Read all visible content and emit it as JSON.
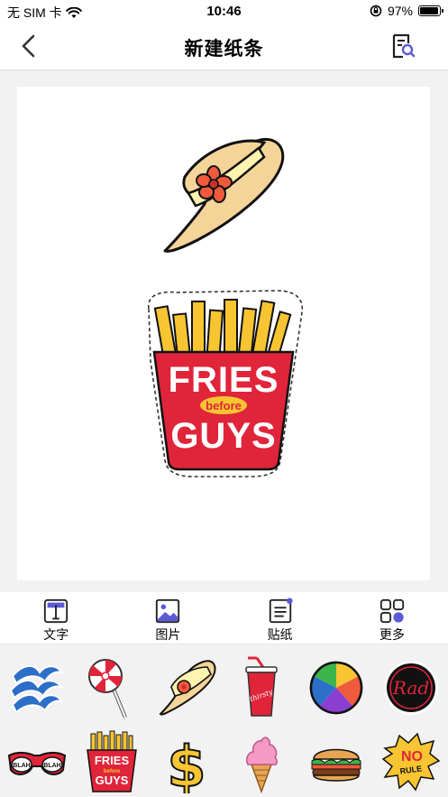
{
  "status_bar": {
    "carrier": "无 SIM 卡",
    "time": "10:46",
    "battery": "97%",
    "battery_level": 0.97
  },
  "nav": {
    "title": "新建纸条",
    "back_icon": "chevron-left-icon",
    "right_icon": "document-search-icon"
  },
  "canvas": {
    "stickers": [
      "sun-hat-sticker",
      "fries-before-guys-sticker"
    ],
    "fries_text": {
      "line1": "FRIES",
      "middle": "before",
      "line2": "GUYS"
    }
  },
  "toolbar": {
    "items": [
      {
        "label": "文字",
        "icon": "text-icon"
      },
      {
        "label": "图片",
        "icon": "image-icon"
      },
      {
        "label": "贴纸",
        "icon": "sticker-icon"
      },
      {
        "label": "更多",
        "icon": "more-grid-icon"
      }
    ]
  },
  "sticker_tray": {
    "items": [
      {
        "name": "blue-waves-sticker"
      },
      {
        "name": "lollipop-sticker"
      },
      {
        "name": "sun-hat-sticker"
      },
      {
        "name": "soda-cup-sticker",
        "text": "thirsty"
      },
      {
        "name": "beach-ball-sticker"
      },
      {
        "name": "rad-badge-sticker",
        "text": "Rad"
      },
      {
        "name": "sunglasses-sticker",
        "text_left": "BLAH",
        "text_right": "BLAH"
      },
      {
        "name": "fries-mini-sticker",
        "text_top": "FRIES",
        "text_mid": "before",
        "text_bottom": "GUYS"
      },
      {
        "name": "dollar-sign-sticker",
        "text": "$"
      },
      {
        "name": "ice-cream-sticker"
      },
      {
        "name": "hamburger-sticker"
      },
      {
        "name": "no-rules-sticker",
        "text_top": "NO",
        "text_bottom": "RULE"
      }
    ]
  },
  "colors": {
    "accent": "#5b5bd6",
    "fries_red": "#e0243a",
    "fries_yellow": "#f7c531",
    "hat_tan": "#f5d49a",
    "hat_flower": "#ef5a3c"
  }
}
